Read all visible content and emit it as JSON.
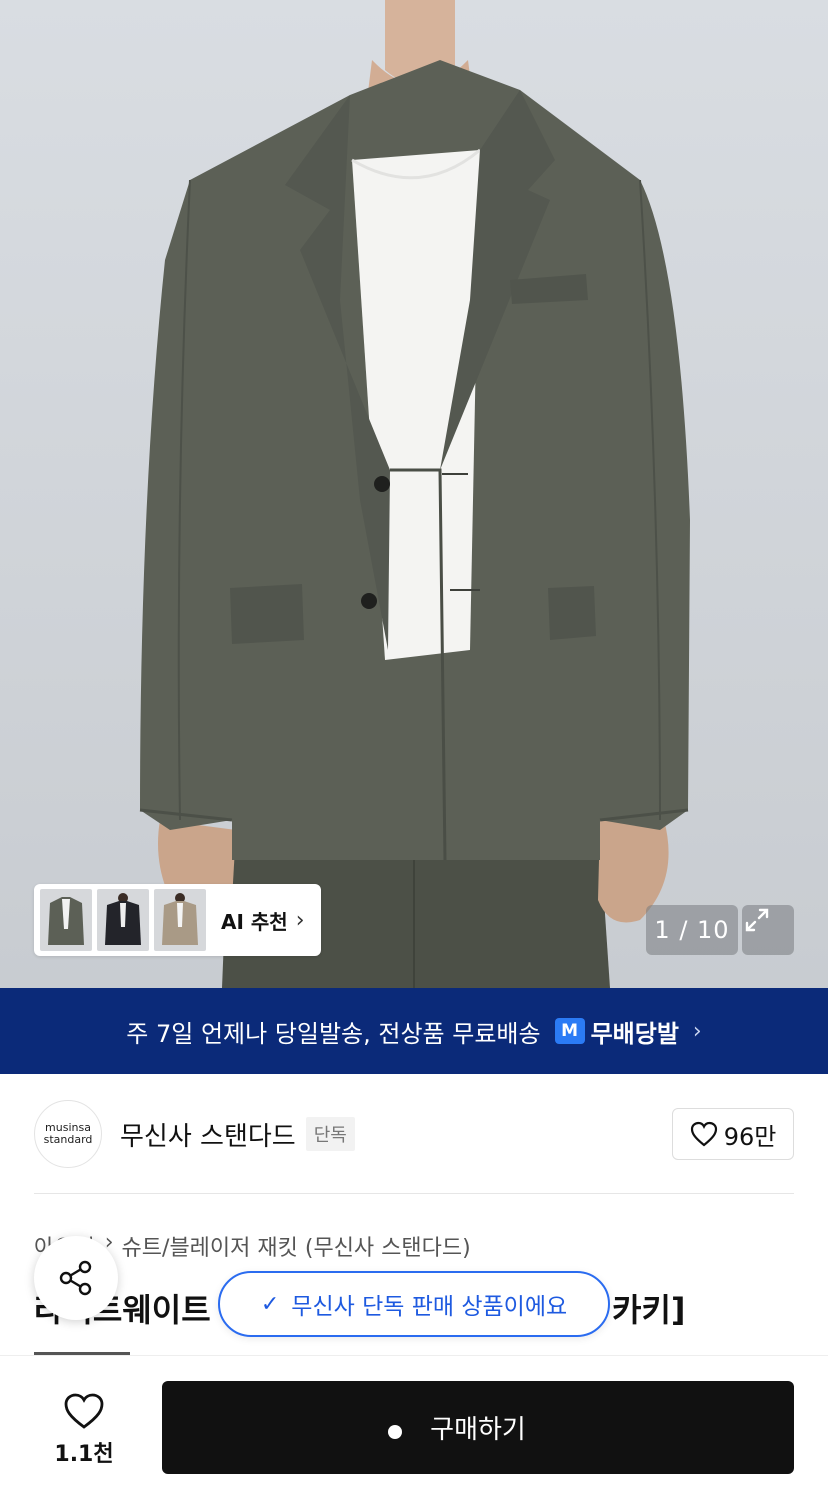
{
  "gallery": {
    "counter": "1 / 10",
    "ai_recommend_label": "AI 추천",
    "thumbnails": [
      "jacket-olive",
      "jacket-black",
      "jacket-beige"
    ]
  },
  "banner": {
    "text": "주 7일 언제나 당일발송, 전상품 무료배송",
    "badge": "M",
    "brand": "무배당발"
  },
  "brand": {
    "logo_line1": "musinsa",
    "logo_line2": "standard",
    "name": "무신사 스탠다드",
    "tag": "단독",
    "likes": "96만"
  },
  "product": {
    "category_home": "아우터",
    "category_path": "슈트/블레이저 재킷 (무신사 스탠다드)",
    "title_visible_left": "라이트웨이트",
    "title_visible_right": "카키]"
  },
  "toast": {
    "text": "무신사 단독 판매 상품이에요"
  },
  "bottom": {
    "wish_count": "1.1천",
    "buy_label": "구매하기"
  },
  "colors": {
    "banner_bg": "#0b2a79",
    "toast_accent": "#2b6cf0",
    "buy_bg": "#111111",
    "jacket": "#5c6056"
  }
}
